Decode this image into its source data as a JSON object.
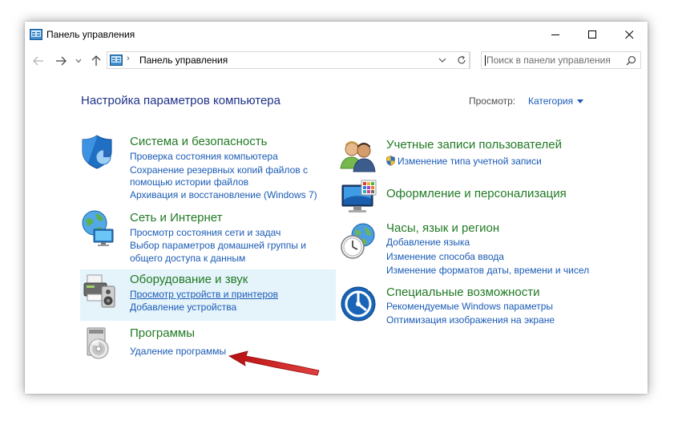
{
  "window": {
    "title": "Панель управления"
  },
  "nav": {
    "address": "Панель управления",
    "search_placeholder": "Поиск в панели управления"
  },
  "content": {
    "heading": "Настройка параметров компьютера",
    "view_by_label": "Просмотр:",
    "view_by_value": "Категория"
  },
  "categories": {
    "system": {
      "title": "Система и безопасность",
      "links": [
        "Проверка состояния компьютера",
        "Сохранение резервных копий файлов с",
        "помощью истории файлов",
        "Архивация и восстановление (Windows 7)"
      ]
    },
    "network": {
      "title": "Сеть и Интернет",
      "links": [
        "Просмотр состояния сети и задач",
        "Выбор параметров домашней группы и",
        "общего доступа к данным"
      ]
    },
    "hardware": {
      "title": "Оборудование и звук",
      "links": [
        "Просмотр устройств и принтеров",
        "Добавление устройства"
      ]
    },
    "programs": {
      "title": "Программы",
      "links": [
        "Удаление программы"
      ]
    },
    "accounts": {
      "title": "Учетные записи пользователей",
      "links": [
        "Изменение типа учетной записи"
      ]
    },
    "appearance": {
      "title": "Оформление и персонализация",
      "links": []
    },
    "clock": {
      "title": "Часы, язык и регион",
      "links": [
        "Добавление языка",
        "Изменение способа ввода",
        "Изменение форматов даты, времени и чисел"
      ]
    },
    "access": {
      "title": "Специальные возможности",
      "links": [
        "Рекомендуемые Windows параметры",
        "Оптимизация изображения на экране"
      ]
    }
  },
  "colors": {
    "link": "#1a5bb5",
    "category_title": "#217a24",
    "heading": "#1e3287",
    "hover": "#e5f3fb",
    "annotation_arrow": "#d42121"
  }
}
